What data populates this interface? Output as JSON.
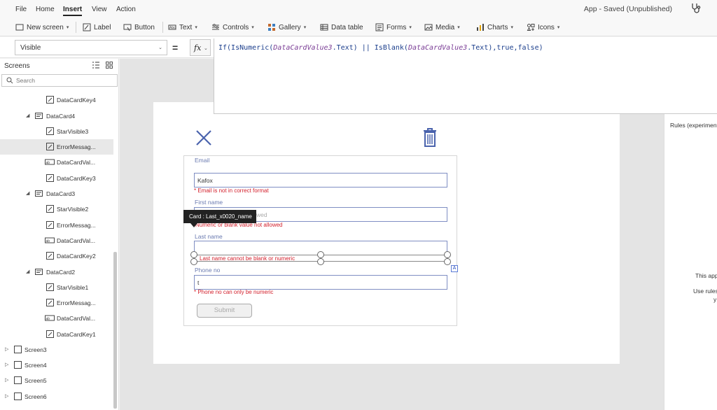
{
  "menubar": {
    "items": [
      "File",
      "Home",
      "Insert",
      "View",
      "Action"
    ],
    "active": "Insert",
    "app_status": "App - Saved (Unpublished)"
  },
  "toolbar": {
    "new_screen": "New screen",
    "label": "Label",
    "button": "Button",
    "text": "Text",
    "controls": "Controls",
    "gallery": "Gallery",
    "data_table": "Data table",
    "forms": "Forms",
    "media": "Media",
    "charts": "Charts",
    "icons": "Icons"
  },
  "formula_bar": {
    "property": "Visible",
    "equals": "=",
    "fx": "fx",
    "formula_parts": [
      {
        "t": "If(IsNumeric(",
        "italic": false
      },
      {
        "t": "DataCardValue3",
        "italic": true
      },
      {
        "t": ".Text) || IsBlank(",
        "italic": false
      },
      {
        "t": "DataCardValue3",
        "italic": true
      },
      {
        "t": ".Text),true,false)",
        "italic": false
      }
    ]
  },
  "left_panel": {
    "title": "Screens",
    "search_placeholder": "Search",
    "tree": [
      {
        "label": "DataCardKey4",
        "type": "edit"
      },
      {
        "label": "DataCard4",
        "type": "card"
      },
      {
        "label": "StarVisible3",
        "type": "edit"
      },
      {
        "label": "ErrorMessag...",
        "type": "edit",
        "selected": true
      },
      {
        "label": "DataCardVal...",
        "type": "input"
      },
      {
        "label": "DataCardKey3",
        "type": "edit"
      },
      {
        "label": "DataCard3",
        "type": "card"
      },
      {
        "label": "StarVisible2",
        "type": "edit"
      },
      {
        "label": "ErrorMessag...",
        "type": "edit"
      },
      {
        "label": "DataCardVal...",
        "type": "input"
      },
      {
        "label": "DataCardKey2",
        "type": "edit"
      },
      {
        "label": "DataCard2",
        "type": "card"
      },
      {
        "label": "StarVisible1",
        "type": "edit"
      },
      {
        "label": "ErrorMessag...",
        "type": "edit"
      },
      {
        "label": "DataCardVal...",
        "type": "input"
      },
      {
        "label": "DataCardKey1",
        "type": "edit"
      },
      {
        "label": "Screen3",
        "type": "screen"
      },
      {
        "label": "Screen4",
        "type": "screen"
      },
      {
        "label": "Screen5",
        "type": "screen"
      },
      {
        "label": "Screen6",
        "type": "screen"
      }
    ]
  },
  "form": {
    "email_label": "Email",
    "email_value": "Kafox",
    "email_error": "* Email is not in correct format",
    "firstname_label": "First name",
    "firstname_placeholder": "wed",
    "firstname_error": "Numeric or blank value not allowed",
    "lastname_label": "Last name",
    "lastname_error": "Last name cannot be blank or numeric",
    "phone_label": "Phone no",
    "phone_value": "t",
    "phone_error": "* Phone no can only be numeric",
    "submit_label": "Submit"
  },
  "tooltip": "Card : Last_x0020_name",
  "right_panel": {
    "title": "Rules (experiment",
    "line1": "This app",
    "line2": "Use rules",
    "line3": "y"
  },
  "colors": {
    "accent": "#2b4fbd",
    "error": "#d3212d",
    "input_border": "#7f8ec3",
    "icon_blue": "#4a63ad"
  }
}
